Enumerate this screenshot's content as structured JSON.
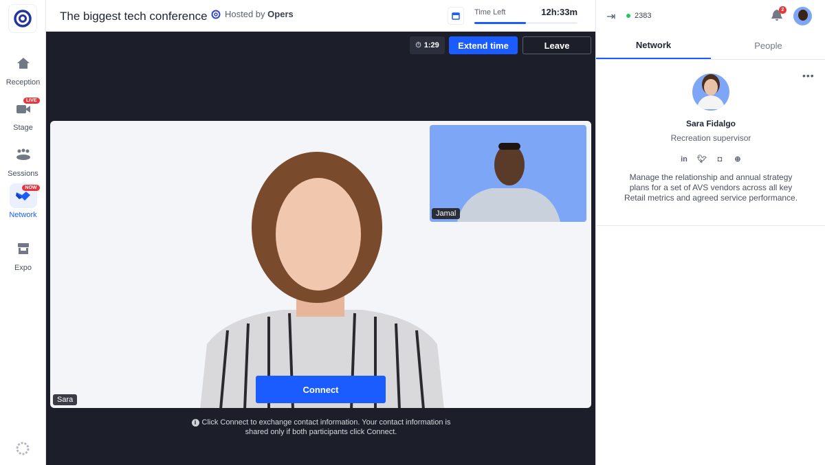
{
  "header": {
    "title": "The biggest tech conference",
    "hosted_by_prefix": "Hosted by",
    "host": "Opers",
    "time_left_label": "Time Left",
    "time_left": "12h:33m",
    "time_progress": 0.5
  },
  "sidebar": {
    "items": [
      {
        "label": "Reception",
        "icon": "home-icon"
      },
      {
        "label": "Stage",
        "icon": "video-camera-icon",
        "badge": "LIVE"
      },
      {
        "label": "Sessions",
        "icon": "people-table-icon"
      },
      {
        "label": "Network",
        "icon": "handshake-icon",
        "badge": "NOW",
        "active": true
      },
      {
        "label": "Expo",
        "icon": "booth-icon"
      }
    ]
  },
  "stage": {
    "timer": "1:29",
    "extend_label": "Extend time",
    "leave_label": "Leave",
    "main_name": "Sara",
    "pip_name": "Jamal",
    "connect_label": "Connect",
    "info_line1": "Click Connect to exchange contact information. Your contact information is",
    "info_line2": "shared only if both participants click Connect."
  },
  "panel": {
    "online_count": "2383",
    "notification_count": "2",
    "tabs": [
      {
        "label": "Network",
        "active": true
      },
      {
        "label": "People"
      }
    ],
    "profile": {
      "name": "Sara Fidalgo",
      "title": "Recreation supervisor",
      "bio": "Manage the relationship and annual strategy plans for a set of AVS vendors across all key Retail metrics and agreed service performance.",
      "socials": [
        "linkedin",
        "twitter",
        "instagram",
        "website"
      ]
    }
  },
  "colors": {
    "accent": "#1a5cff",
    "dark": "#1c1f2a",
    "live": "#e8363b",
    "online": "#22c55e",
    "pip_bg": "#7ea6f7"
  }
}
